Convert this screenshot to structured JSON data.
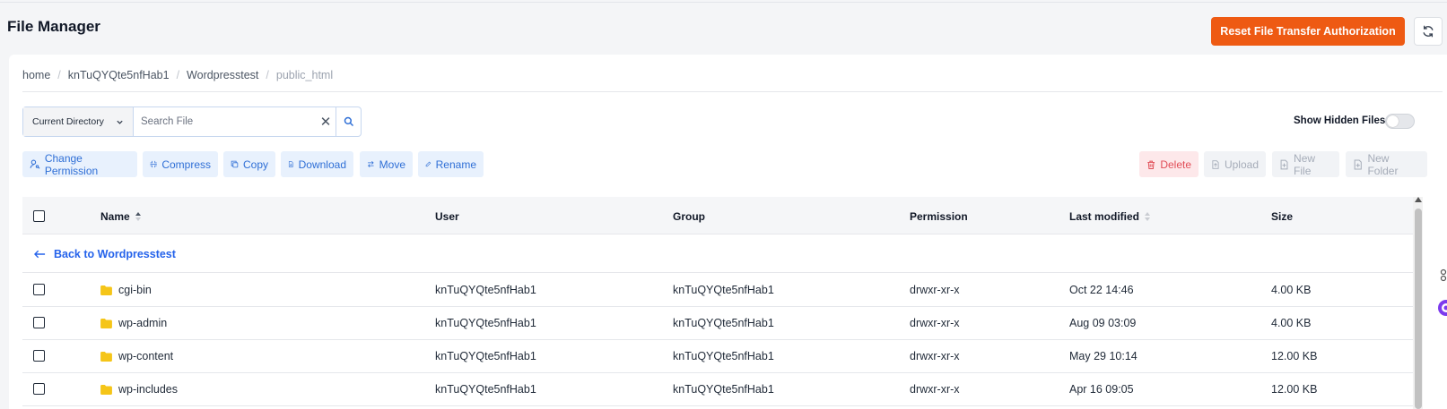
{
  "header": {
    "title": "File Manager",
    "reset_label": "Reset File Transfer Authorization",
    "accent": "#ee5a13"
  },
  "breadcrumb": [
    "home",
    "knTuQYQte5nfHab1",
    "Wordpresstest",
    "public_html"
  ],
  "search": {
    "scope": "Current Directory",
    "placeholder": "Search File",
    "value": ""
  },
  "show_hidden": {
    "label": "Show Hidden Files",
    "on": false
  },
  "actions": {
    "change_permission": "Change Permission",
    "compress": "Compress",
    "copy": "Copy",
    "download": "Download",
    "move": "Move",
    "rename": "Rename",
    "delete": "Delete",
    "upload": "Upload",
    "new_file": "New File",
    "new_folder": "New Folder"
  },
  "table": {
    "columns": [
      "Name",
      "User",
      "Group",
      "Permission",
      "Last modified",
      "Size"
    ],
    "back_label": "Back to Wordpresstest",
    "rows": [
      {
        "name": "cgi-bin",
        "user": "knTuQYQte5nfHab1",
        "group": "knTuQYQte5nfHab1",
        "permission": "drwxr-xr-x",
        "modified": "Oct 22 14:46",
        "size": "4.00 KB"
      },
      {
        "name": "wp-admin",
        "user": "knTuQYQte5nfHab1",
        "group": "knTuQYQte5nfHab1",
        "permission": "drwxr-xr-x",
        "modified": "Aug 09 03:09",
        "size": "4.00 KB"
      },
      {
        "name": "wp-content",
        "user": "knTuQYQte5nfHab1",
        "group": "knTuQYQte5nfHab1",
        "permission": "drwxr-xr-x",
        "modified": "May 29 10:14",
        "size": "12.00 KB"
      },
      {
        "name": "wp-includes",
        "user": "knTuQYQte5nfHab1",
        "group": "knTuQYQte5nfHab1",
        "permission": "drwxr-xr-x",
        "modified": "Apr 16 09:05",
        "size": "12.00 KB"
      }
    ]
  }
}
